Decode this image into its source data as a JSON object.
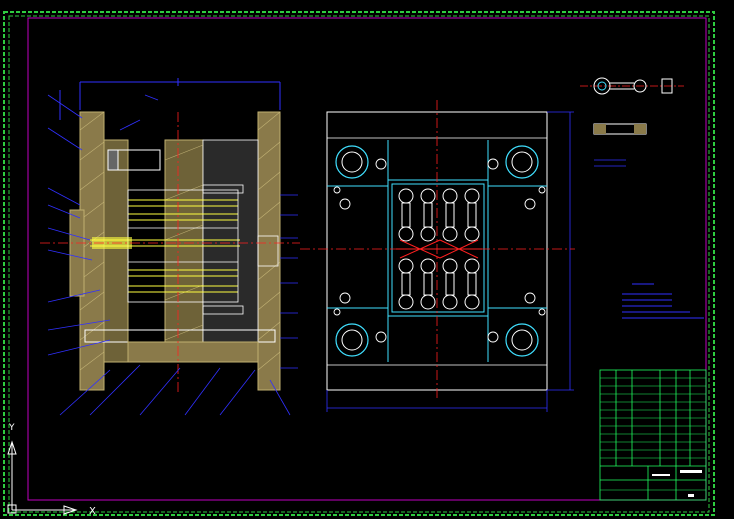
{
  "app": {
    "view": "cad-drawing-canvas"
  },
  "colors": {
    "background": "#000000",
    "outer_frame": "#2ecc40",
    "inner_frame": "#c000c0",
    "outline": "#ffffff",
    "dimension": "#3030ff",
    "centerline": "#ff2020",
    "hatch": "#b8a060",
    "cyan_detail": "#40e0ff",
    "yellow_detail": "#ffff40",
    "title_block": "#20ff60"
  },
  "icons": {
    "ucs": "ucs-axis-icon",
    "y_axis": "y-arrow-icon",
    "x_axis": "x-arrow-icon"
  },
  "axis": {
    "y_label": "Y",
    "x_label": "X"
  }
}
